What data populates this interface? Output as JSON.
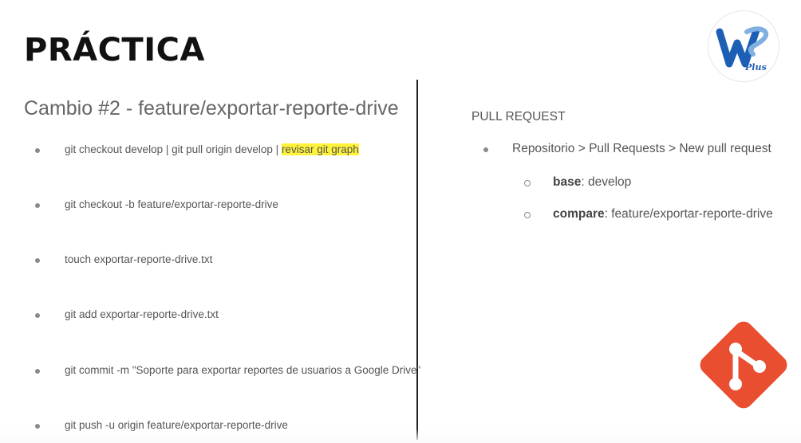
{
  "slide": {
    "title": "PRÁCTICA",
    "logo": {
      "icon": "ws-plus-logo",
      "text": "Plus",
      "colors": {
        "blue": "#1d5fb5",
        "light_blue": "#7fb0e2"
      }
    },
    "left": {
      "subtitle": "Cambio #2 - feature/exportar-reporte-drive",
      "steps": [
        {
          "text": "git checkout develop | git pull origin develop | ",
          "highlight": "revisar git graph"
        },
        {
          "text": "git checkout -b feature/exportar-reporte-drive"
        },
        {
          "text": "touch exportar-reporte-drive.txt"
        },
        {
          "text": "git add exportar-reporte-drive.txt"
        },
        {
          "text": "git commit -m \"Soporte para exportar  reportes de usuarios a Google Drive\""
        },
        {
          "text": "git push -u origin feature/exportar-reporte-drive"
        }
      ]
    },
    "right": {
      "heading": "PULL REQUEST",
      "item": "Repositorio > Pull Requests > New pull request",
      "subitems": [
        {
          "label": "base",
          "value": ": develop"
        },
        {
          "label": "compare",
          "value": ": feature/exportar-reporte-drive"
        }
      ]
    },
    "git_logo": {
      "icon": "git-logo-icon",
      "color": "#e94e31"
    },
    "highlight_color": "#fff23a"
  }
}
